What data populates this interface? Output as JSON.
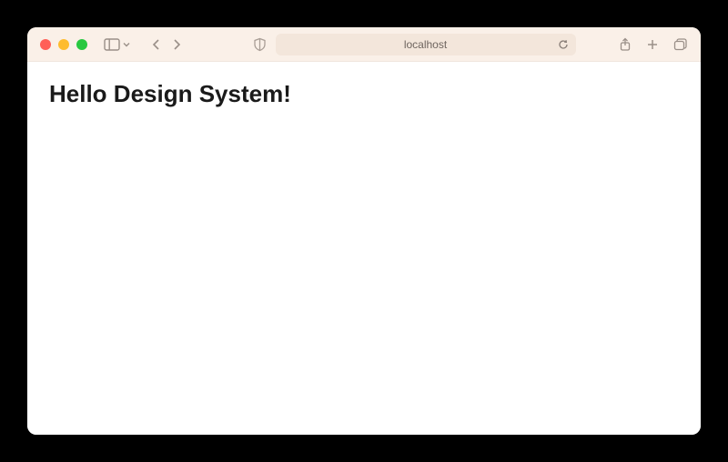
{
  "window": {
    "address": "localhost"
  },
  "page": {
    "heading": "Hello Design System!"
  },
  "icons": {
    "sidebar": "sidebar-icon",
    "chevron_down": "chevron-down-icon",
    "back": "back-icon",
    "forward": "forward-icon",
    "shield": "privacy-shield-icon",
    "reload": "reload-icon",
    "share": "share-icon",
    "new_tab": "new-tab-icon",
    "tabs": "tab-overview-icon",
    "close": "close-window-icon",
    "minimize": "minimize-window-icon",
    "fullscreen": "fullscreen-window-icon"
  }
}
